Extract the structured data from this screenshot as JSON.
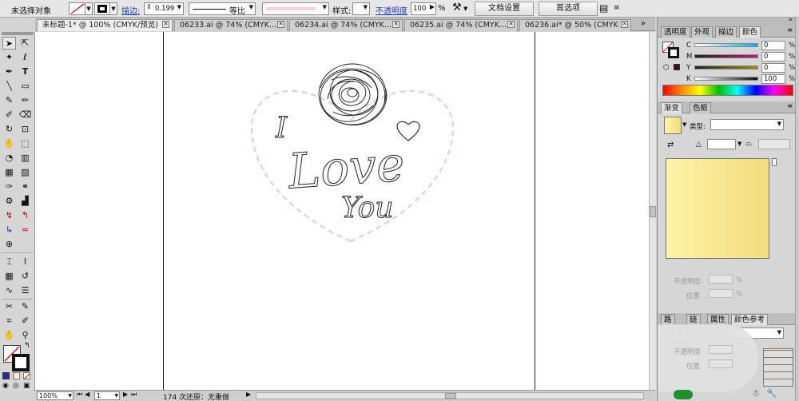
{
  "control_bar": {
    "selection_state": "未选择对象",
    "stroke_label": "描边:",
    "stroke_value": "0.199",
    "profile_label": "等比",
    "style_label": "样式:",
    "opacity_label": "不透明度",
    "opacity_value": "100",
    "opacity_unit": "%",
    "doc_setup_label": "文档设置",
    "preferences_label": "首选项"
  },
  "tabs": [
    {
      "label": "未标题-1* @ 100% (CMYK/预览)",
      "active": true
    },
    {
      "label": "06233.ai @ 74% (CMYK...",
      "active": false
    },
    {
      "label": "06234.ai @ 74% (CMYK...",
      "active": false
    },
    {
      "label": "06235.ai @ 74% (CMYK...",
      "active": false
    },
    {
      "label": "06236.ai* @ 50% (CMYK",
      "active": false
    }
  ],
  "tab_close_glyph": "✕",
  "status_bar": {
    "zoom": "100%",
    "artboard_num": "1",
    "undo_text": "174 次还原：无重做"
  },
  "artwork": {
    "word_i": "I",
    "word_love": "Love",
    "word_you": "You"
  },
  "color_panel": {
    "tabs": [
      "透明度",
      "外观",
      "描边",
      "颜色"
    ],
    "channels": [
      {
        "name": "C",
        "value": "0"
      },
      {
        "name": "M",
        "value": "0"
      },
      {
        "name": "Y",
        "value": "0"
      },
      {
        "name": "K",
        "value": "100"
      }
    ]
  },
  "gradient_panel": {
    "tabs": [
      "渐变",
      "色板"
    ],
    "type_label": "类型:",
    "opacity_label": "不透明度",
    "position_label": "位置",
    "percent": "%",
    "gradient_from": "#fdf3a8",
    "gradient_to": "#f3dc7c"
  },
  "bottom_panel": {
    "tabs": [
      "路",
      "链",
      "属性",
      "颜色参考"
    ],
    "opacity_label": "不透明度",
    "position_label": "位置"
  },
  "colors": {
    "heart_dash": "#f2c9cf",
    "link_blue": "#1f3fbf"
  }
}
